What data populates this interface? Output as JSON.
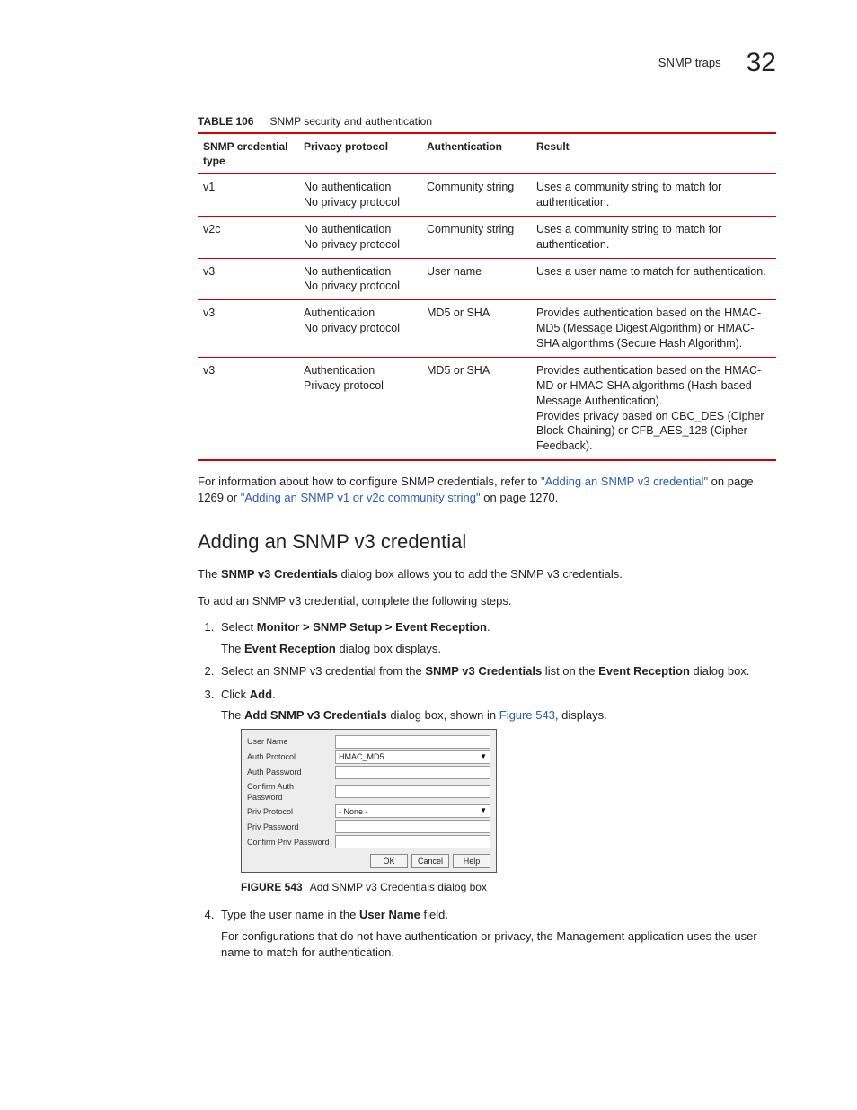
{
  "header": {
    "title": "SNMP traps",
    "chapter": "32"
  },
  "table": {
    "caption_label": "TABLE 106",
    "caption_text": "SNMP security and authentication",
    "headers": [
      "SNMP credential type",
      "Privacy protocol",
      "Authentication",
      "Result"
    ],
    "rows": [
      {
        "c0": "v1",
        "c1": "No authentication\nNo privacy protocol",
        "c2": "Community string",
        "c3": "Uses a community string to match for authentication."
      },
      {
        "c0": "v2c",
        "c1": "No authentication\nNo privacy protocol",
        "c2": "Community string",
        "c3": "Uses a community string to match for authentication."
      },
      {
        "c0": "v3",
        "c1": "No authentication\nNo privacy protocol",
        "c2": "User name",
        "c3": "Uses a user name to match for authentication."
      },
      {
        "c0": "v3",
        "c1": "Authentication\nNo privacy protocol",
        "c2": "MD5 or SHA",
        "c3": "Provides authentication based on the HMAC-MD5 (Message Digest Algorithm) or HMAC-SHA algorithms (Secure Hash Algorithm)."
      },
      {
        "c0": "v3",
        "c1": "Authentication\nPrivacy protocol",
        "c2": "MD5 or SHA",
        "c3": "Provides authentication based on the HMAC-MD or HMAC-SHA algorithms (Hash-based Message Authentication).\nProvides privacy based on CBC_DES (Cipher Block Chaining) or CFB_AES_128 (Cipher Feedback)."
      }
    ]
  },
  "intro": {
    "pre": "For information about how to configure SNMP credentials, refer to ",
    "link1": "\"Adding an SNMP v3 credential\"",
    "mid": " on page 1269 or ",
    "link2": "\"Adding an SNMP v1 or v2c community string\"",
    "post": " on page 1270."
  },
  "section": {
    "heading": "Adding an SNMP v3 credential",
    "p1a": "The ",
    "p1b": "SNMP v3 Credentials",
    "p1c": " dialog box allows you to add the SNMP v3 credentials.",
    "p2": "To add an SNMP v3 credential, complete the following steps."
  },
  "steps": {
    "s1a": "Select ",
    "s1b": "Monitor > SNMP Setup > Event Reception",
    "s1c": ".",
    "s1suba": "The ",
    "s1subb": "Event Reception",
    "s1subc": " dialog box displays.",
    "s2a": "Select an SNMP v3 credential from the ",
    "s2b": "SNMP v3 Credentials",
    "s2c": " list on the ",
    "s2d": "Event Reception",
    "s2e": " dialog box.",
    "s3a": "Click ",
    "s3b": "Add",
    "s3c": ".",
    "s3suba": "The ",
    "s3subb": "Add SNMP v3 Credentials",
    "s3subc": " dialog box, shown in ",
    "s3link": "Figure 543",
    "s3subd": ", displays.",
    "s4a": "Type the user name in the ",
    "s4b": "User Name",
    "s4c": " field.",
    "s4sub": "For configurations that do not have authentication or privacy, the Management application uses the user name to match for authentication."
  },
  "dialog": {
    "labels": {
      "user": "User Name",
      "authproto": "Auth Protocol",
      "authpw": "Auth Password",
      "confauthpw": "Confirm Auth Password",
      "privproto": "Priv Protocol",
      "privpw": "Priv Password",
      "confprivpw": "Confirm Priv Password"
    },
    "values": {
      "authproto": "HMAC_MD5",
      "privproto": "- None -"
    },
    "buttons": {
      "ok": "OK",
      "cancel": "Cancel",
      "help": "Help"
    }
  },
  "figure": {
    "label": "FIGURE 543",
    "text": "Add SNMP v3 Credentials dialog box"
  }
}
